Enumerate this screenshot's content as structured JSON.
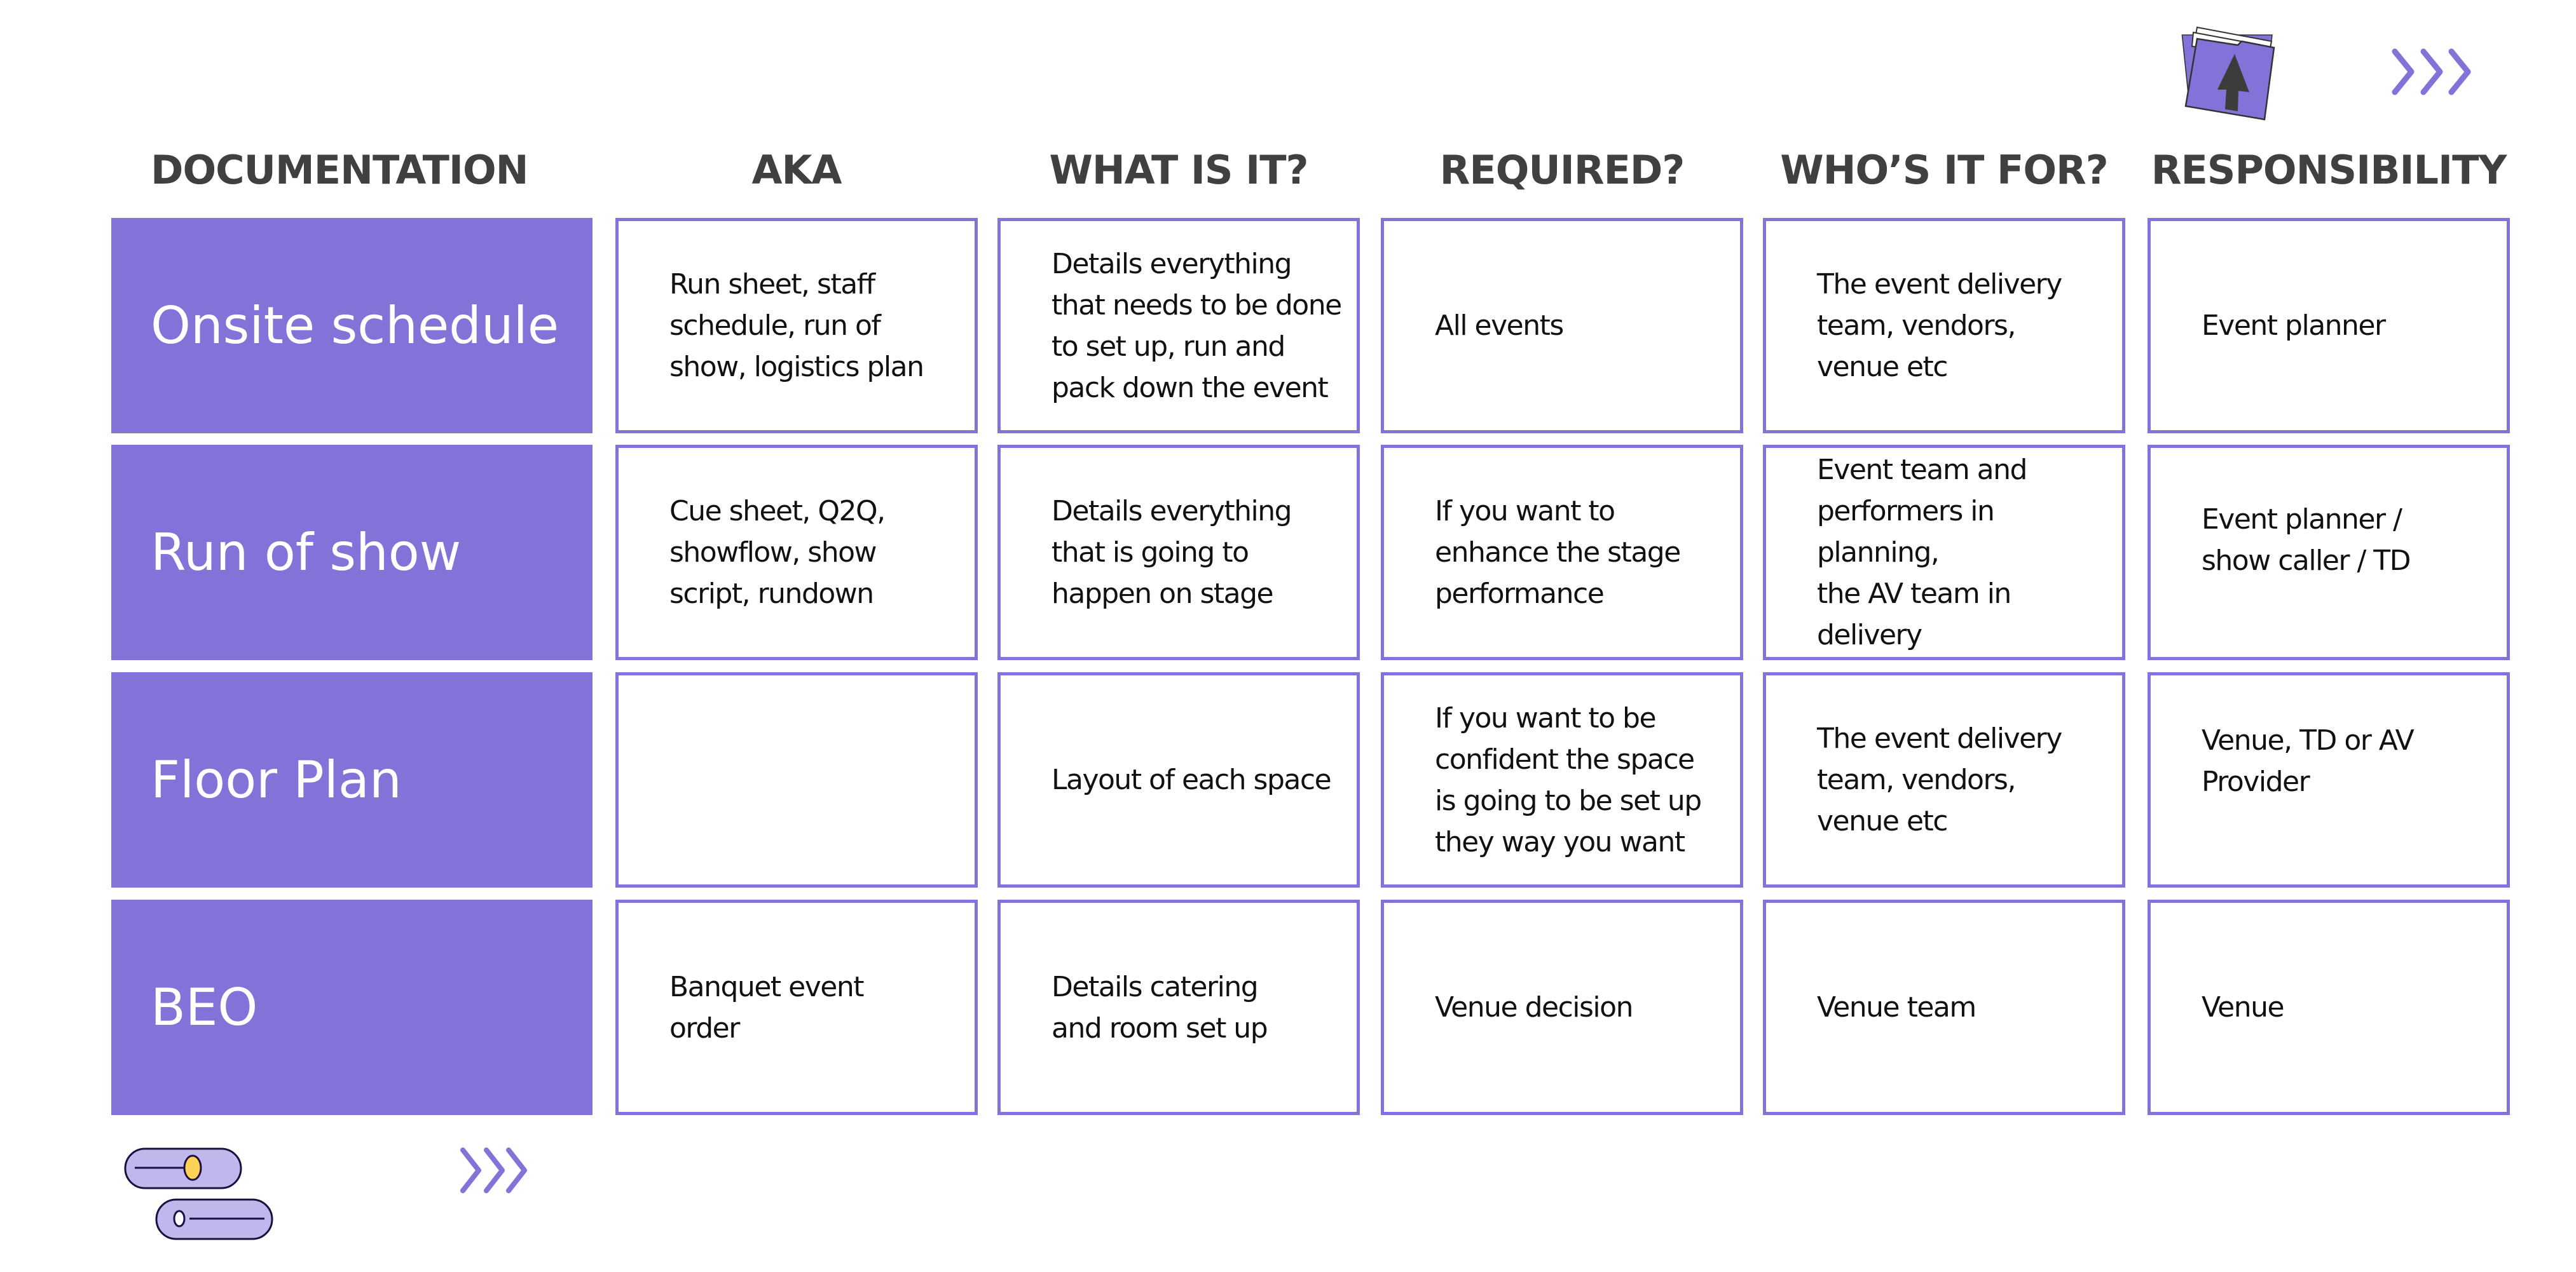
{
  "colors": {
    "accent": "#8273d9",
    "accent_light": "#c0b8ec",
    "knob": "#ffd257",
    "heading": "#404040"
  },
  "icons": {
    "top_right": [
      "upload-folder-icon",
      "chevrons-right-icon"
    ],
    "bottom_left": [
      "sliders-icon",
      "chevrons-right-icon"
    ]
  },
  "headers": [
    "DOCUMENTATION",
    "AKA",
    "WHAT IS IT?",
    "REQUIRED?",
    "WHO’S IT FOR?",
    "RESPONSIBILITY"
  ],
  "rows": [
    {
      "documentation": "Onsite schedule",
      "aka": "Run sheet, staff\nschedule, run of\nshow, logistics plan",
      "what": "Details everything\nthat needs to be done\nto set up, run and\npack down the event",
      "required": "All events",
      "who": "The event delivery\nteam, vendors,\nvenue etc",
      "responsibility": "Event planner"
    },
    {
      "documentation": "Run of show",
      "aka": "Cue sheet, Q2Q,\nshowflow, show\nscript, rundown",
      "what": "Details everything\nthat is going to\nhappen on stage",
      "required": "If you want to\nenhance the stage\nperformance",
      "who": "Event team and\nperformers in planning,\nthe AV team in delivery",
      "responsibility": "Event planner /\nshow caller / TD"
    },
    {
      "documentation": "Floor Plan",
      "aka": "",
      "what": "Layout of each space",
      "required": "If you want to be\nconfident the space\nis going to be set up\nthey way you want",
      "who": "The event delivery\nteam, vendors,\nvenue etc",
      "responsibility": "Venue, TD or AV\nProvider"
    },
    {
      "documentation": "BEO",
      "aka": "Banquet event\norder",
      "what": "Details catering\nand room set up",
      "required": "Venue decision",
      "who": "Venue team",
      "responsibility": "Venue"
    }
  ]
}
